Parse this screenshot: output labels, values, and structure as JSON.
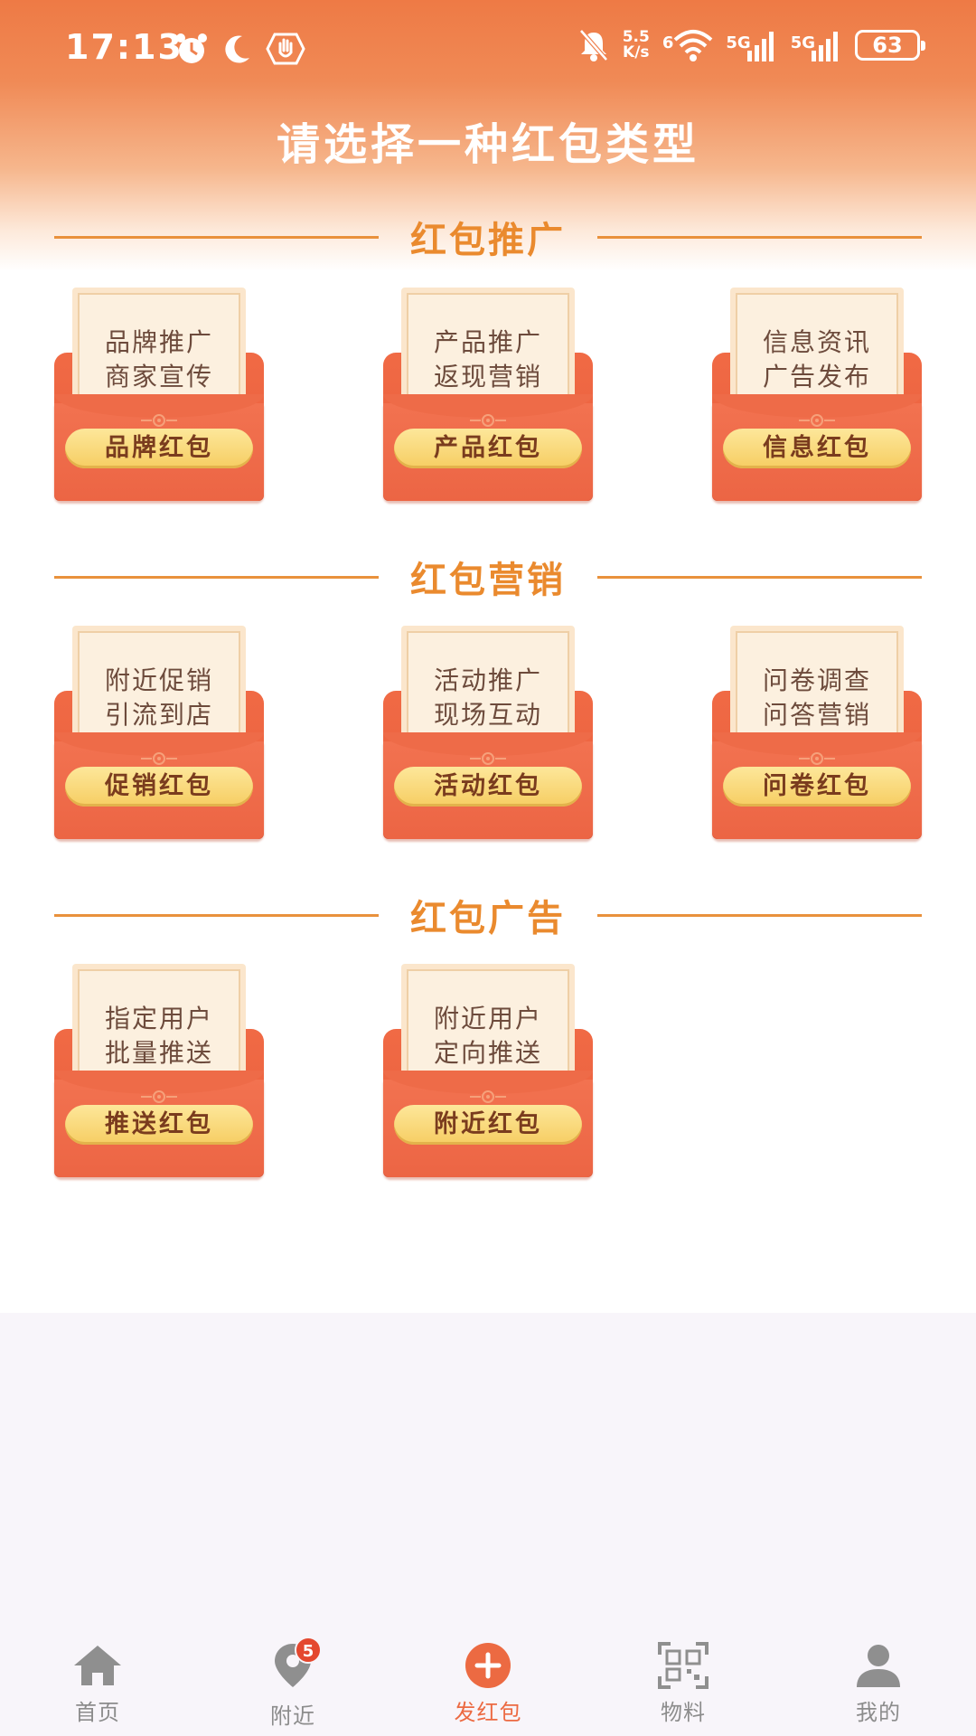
{
  "status_bar": {
    "time": "17:13",
    "net_speed_value": "5.5",
    "net_speed_unit": "K/s",
    "wifi_badge": "6",
    "sim1_label": "5G",
    "sim2_label": "5G",
    "battery": "63"
  },
  "page": {
    "title": "请选择一种红包类型"
  },
  "sections": [
    {
      "title": "红包推广",
      "cards": [
        {
          "line1": "品牌推广",
          "line2": "商家宣传",
          "button": "品牌红包"
        },
        {
          "line1": "产品推广",
          "line2": "返现营销",
          "button": "产品红包"
        },
        {
          "line1": "信息资讯",
          "line2": "广告发布",
          "button": "信息红包"
        }
      ]
    },
    {
      "title": "红包营销",
      "cards": [
        {
          "line1": "附近促销",
          "line2": "引流到店",
          "button": "促销红包"
        },
        {
          "line1": "活动推广",
          "line2": "现场互动",
          "button": "活动红包"
        },
        {
          "line1": "问卷调查",
          "line2": "问答营销",
          "button": "问卷红包"
        }
      ]
    },
    {
      "title": "红包广告",
      "cards": [
        {
          "line1": "指定用户",
          "line2": "批量推送",
          "button": "推送红包"
        },
        {
          "line1": "附近用户",
          "line2": "定向推送",
          "button": "附近红包"
        }
      ]
    }
  ],
  "bottom_nav": {
    "items": [
      {
        "label": "首页",
        "icon": "home-icon"
      },
      {
        "label": "附近",
        "icon": "location-pin-icon",
        "badge": "5"
      },
      {
        "label": "发红包",
        "icon": "plus-circle-icon",
        "active": true
      },
      {
        "label": "物料",
        "icon": "qr-code-icon"
      },
      {
        "label": "我的",
        "icon": "user-icon"
      }
    ]
  },
  "colors": {
    "header": "#ee7a45",
    "section_title": "#ea8a2e",
    "envelope": "#ec6544",
    "pill": "#f6cd62",
    "active_nav": "#ec6a42",
    "inactive_nav": "#8c8c8c"
  }
}
